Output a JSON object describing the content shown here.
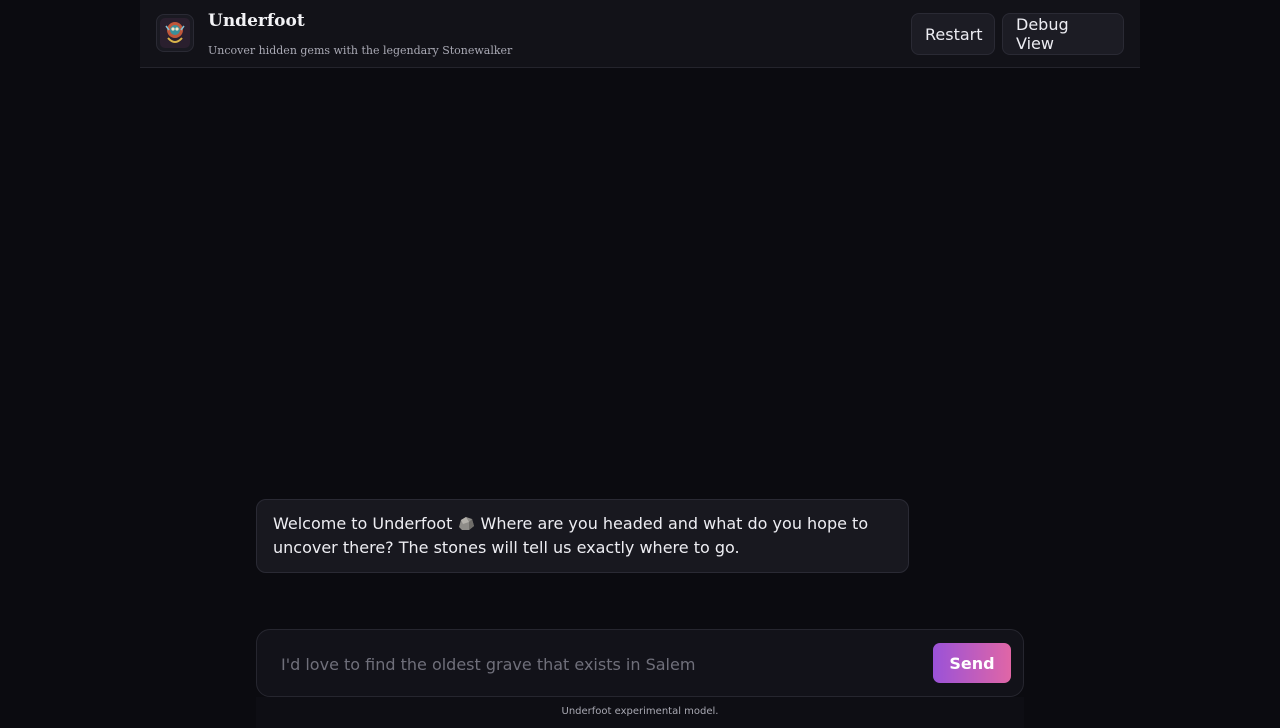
{
  "app": {
    "title": "Underfoot",
    "subtitle": "Uncover hidden gems with the legendary Stonewalker",
    "logo_icon": "stonewalker-logo-icon"
  },
  "header": {
    "restart_label": "Restart",
    "debug_label": "Debug View"
  },
  "chat": {
    "messages": [
      {
        "role": "assistant",
        "text_before_icon": "Welcome to Underfoot ",
        "icon": "rock-icon",
        "text_after_icon": " Where are you headed and what do you hope to uncover there? The stones will tell us exactly where to go."
      }
    ]
  },
  "composer": {
    "placeholder": "I'd love to find the oldest grave that exists in Salem",
    "value": "",
    "send_label": "Send"
  },
  "footer": {
    "note": "Underfoot experimental model."
  },
  "colors": {
    "background": "#0b0b10",
    "header_bg": "#121218",
    "send_gradient_start": "#9a52d8",
    "send_gradient_end": "#e066a6"
  }
}
